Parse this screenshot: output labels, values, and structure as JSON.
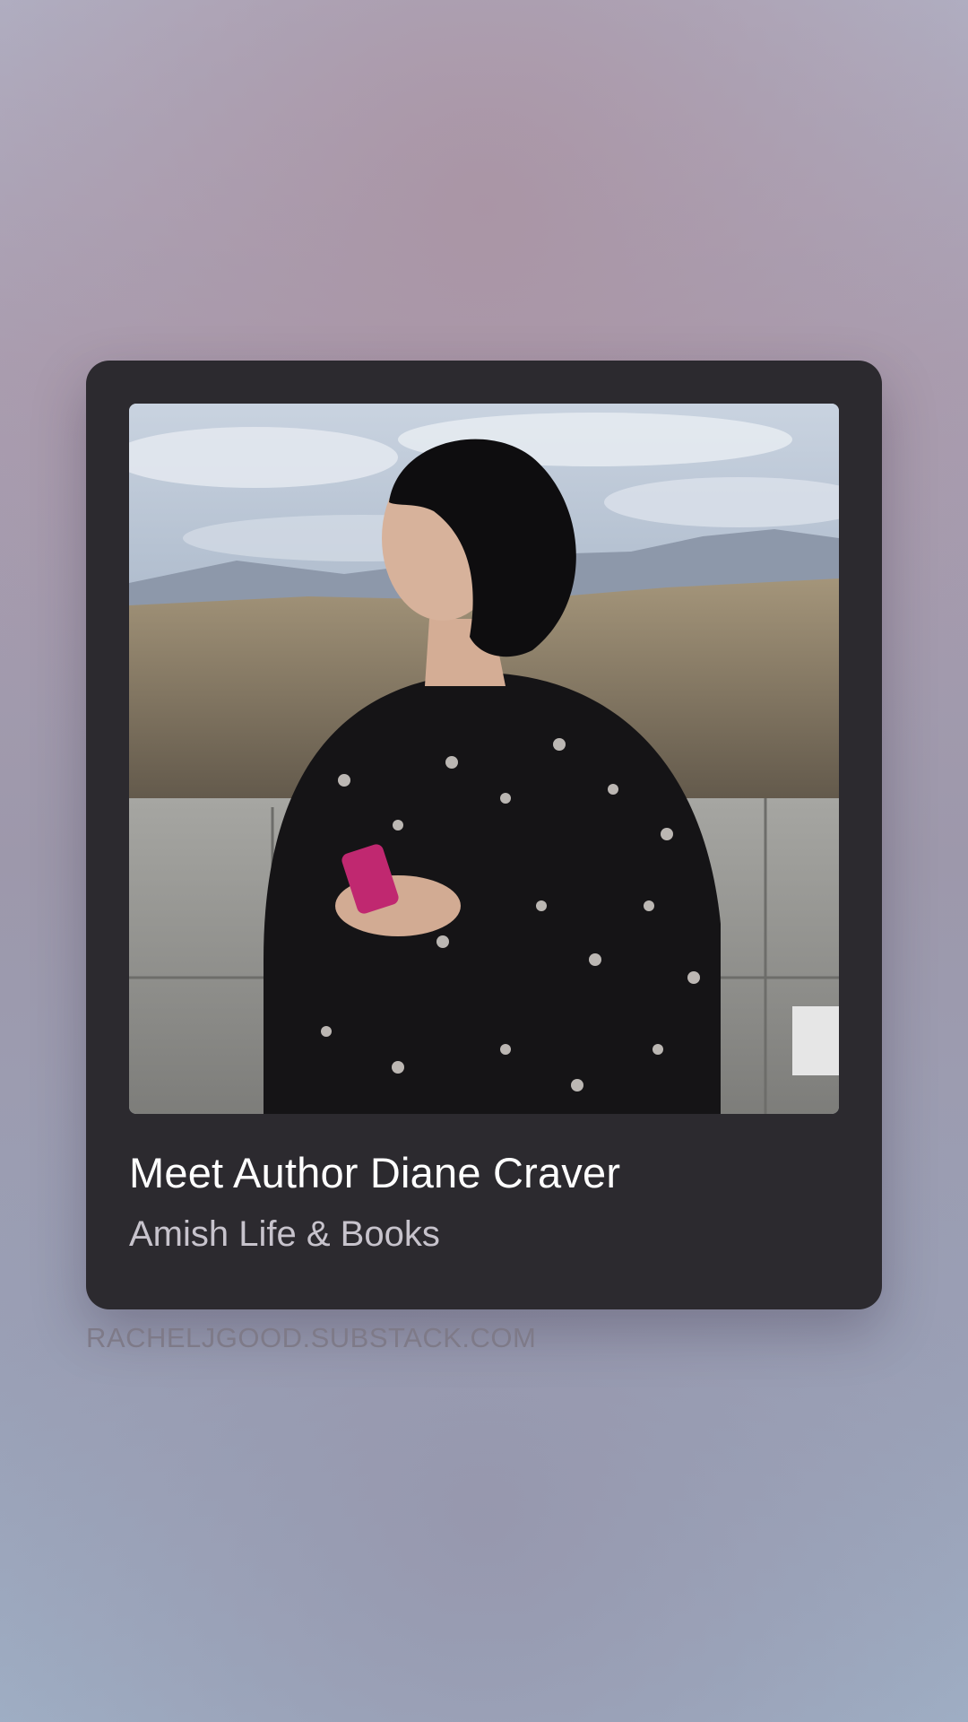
{
  "card": {
    "title": "Meet Author Diane Craver",
    "subtitle": "Amish Life & Books",
    "image_icon": "substack-bookmark-icon"
  },
  "source": {
    "domain": "RACHELJGOOD.SUBSTACK.COM"
  },
  "colors": {
    "card_background": "#2c2a2f",
    "title_text": "#ffffff",
    "subtitle_text": "#c7c3cc",
    "domain_text": "#7e7a88"
  }
}
